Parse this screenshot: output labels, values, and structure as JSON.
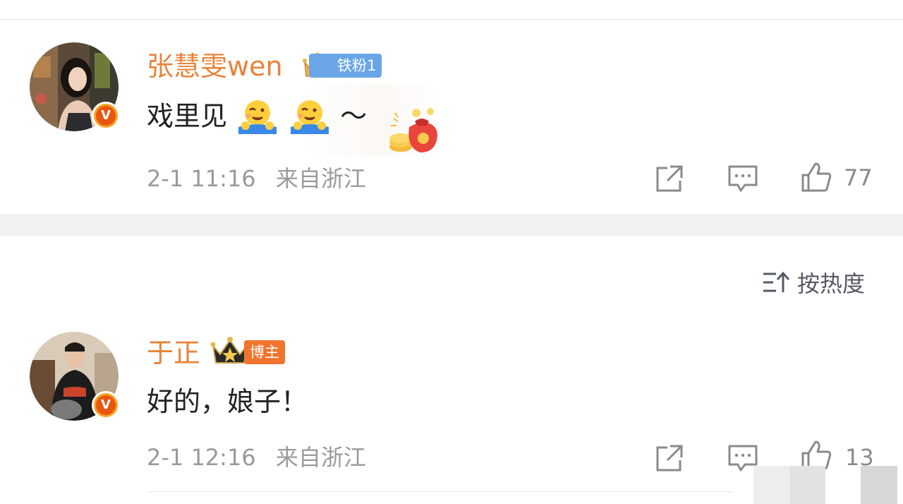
{
  "comment1": {
    "username": "张慧雯wen",
    "fan_badge": "铁粉1",
    "text": "戏里见",
    "text_suffix": "～",
    "emojis": [
      "wink-hug-emoji",
      "wink-hug-emoji"
    ],
    "date": "2-1 11:16",
    "location": "来自浙江",
    "likes": "77"
  },
  "sort": {
    "label": "按热度"
  },
  "comment2": {
    "username": "于正",
    "role_badge": "博主",
    "text": "好的，娘子！",
    "date": "2-1 12:16",
    "location": "来自浙江",
    "likes": "13"
  },
  "colors": {
    "username": "#e8833a",
    "fan_badge": "#6aa6e6",
    "blogger_badge": "#f0742d",
    "verified_badge": "#f5a623"
  }
}
